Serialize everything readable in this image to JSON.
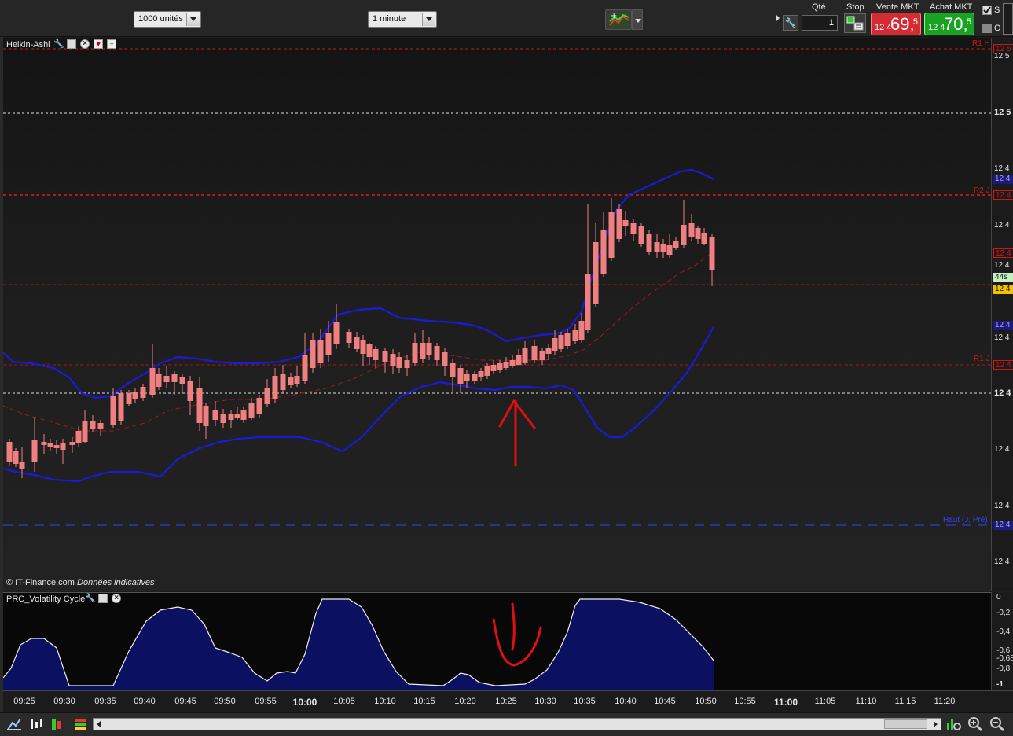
{
  "toolbar": {
    "units": "1000 unités",
    "period": "1 minute"
  },
  "order": {
    "qty_label": "Qté",
    "qty_value": "1",
    "stop_label": "Stop",
    "sell_label": "Vente MKT",
    "sell_price_prefix": "12 4",
    "sell_price_main": "69,",
    "sell_price_frac": "5",
    "buy_label": "Achat MKT",
    "buy_price_prefix": "12 4",
    "buy_price_main": "70,",
    "buy_price_frac": "5",
    "check_s": "S",
    "check_o": "O",
    "colors": {
      "sell": "#d42c34",
      "buy": "#19a325"
    }
  },
  "chart": {
    "title": "Heikin-Ashi",
    "credit_brand": "© IT-Finance.com",
    "credit_note": "Données indicatives",
    "levels": {
      "r1h": "R1 H",
      "r2j": "R2 J",
      "r1j": "R1 J",
      "haut": "Haut (J, Pré)"
    },
    "annotations": {
      "arrow_color": "#e01010"
    },
    "colors": {
      "up": "#6fe06f",
      "down": "#f08080",
      "band": "#1a1ad8",
      "level": "#d01515"
    },
    "price_axis": {
      "top_level_badge": "12 5",
      "labels": [
        "12 5",
        "12 5",
        "12 4",
        "12 4",
        "12 4",
        "12 4",
        "12 4",
        "12 4",
        "12 4",
        "12 4"
      ],
      "blue_badge_top": "12 4",
      "r2_badge": "12 4",
      "mid_badge": "12 4",
      "countdown": "44s",
      "last_price": "12 4",
      "blue_badge_mid": "12 4",
      "r1_badge": "12 4",
      "bottom_blue_badge": "12 4"
    }
  },
  "oscillator": {
    "title": "PRC_Volatility Cycle",
    "axis": [
      "0",
      "-0,2",
      "-0,4",
      "-0,6",
      "-0,68",
      "-0,8",
      "-1"
    ],
    "fill_color": "#0c1060"
  },
  "time_axis": [
    "09:25",
    "09:30",
    "09:35",
    "09:40",
    "09:45",
    "09:50",
    "09:55",
    "10:00",
    "10:05",
    "10:10",
    "10:15",
    "10:20",
    "10:25",
    "10:30",
    "10:35",
    "10:40",
    "10:45",
    "10:50",
    "10:55",
    "11:00",
    "11:05",
    "11:10",
    "11:15",
    "11:20"
  ],
  "bottom_bar": {
    "icons": [
      "chart-type-icon",
      "indicator-icon",
      "bar-style-icon",
      "color-icon",
      "zoom-fit-icon",
      "zoom-in-icon",
      "zoom-out-icon"
    ]
  }
}
